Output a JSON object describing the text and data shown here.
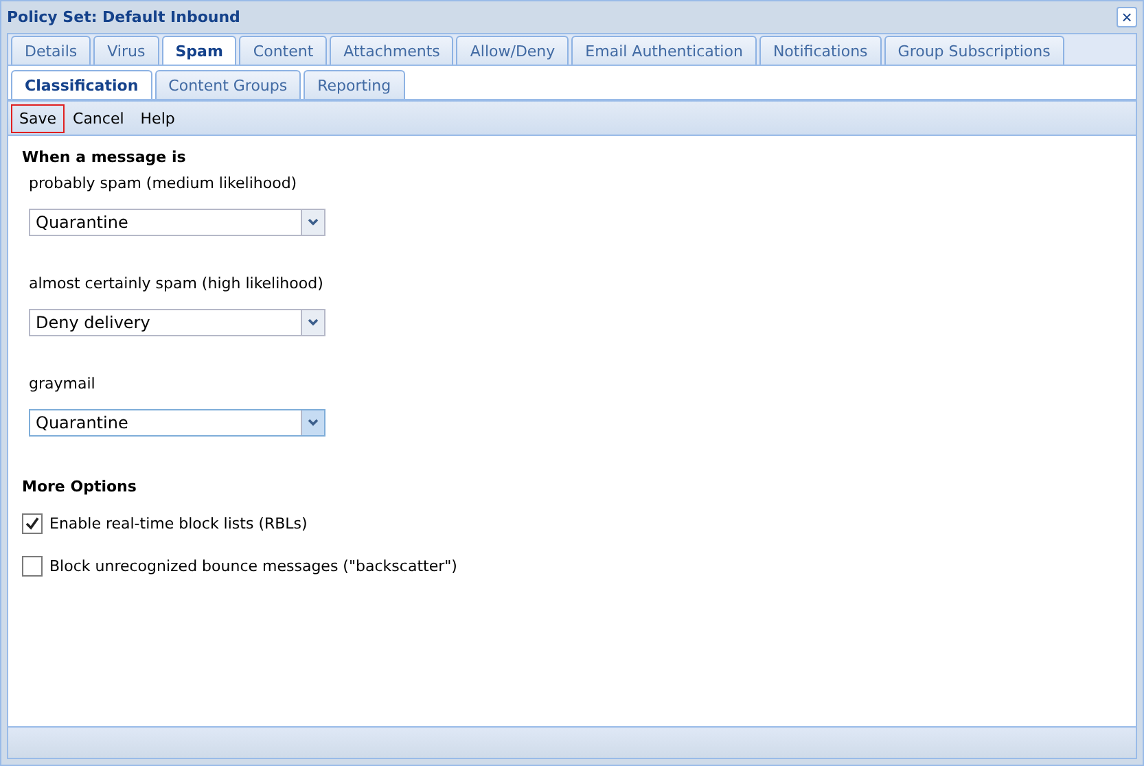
{
  "window": {
    "title": "Policy Set: Default Inbound",
    "close": "×"
  },
  "tabs": [
    {
      "label": "Details",
      "selected": false
    },
    {
      "label": "Virus",
      "selected": false
    },
    {
      "label": "Spam",
      "selected": true
    },
    {
      "label": "Content",
      "selected": false
    },
    {
      "label": "Attachments",
      "selected": false
    },
    {
      "label": "Allow/Deny",
      "selected": false
    },
    {
      "label": "Email Authentication",
      "selected": false
    },
    {
      "label": "Notifications",
      "selected": false
    },
    {
      "label": "Group Subscriptions",
      "selected": false
    }
  ],
  "subtabs": [
    {
      "label": "Classification",
      "selected": true
    },
    {
      "label": "Content Groups",
      "selected": false
    },
    {
      "label": "Reporting",
      "selected": false
    }
  ],
  "toolbar": [
    {
      "label": "Save",
      "focused": true
    },
    {
      "label": "Cancel",
      "focused": false
    },
    {
      "label": "Help",
      "focused": false
    }
  ],
  "section_title": "When a message is",
  "selects": [
    {
      "label": "probably spam (medium likelihood)",
      "value": "Quarantine",
      "focused": false
    },
    {
      "label": "almost certainly spam (high likelihood)",
      "value": "Deny delivery",
      "focused": false
    },
    {
      "label": "graymail",
      "value": "Quarantine",
      "focused": true
    }
  ],
  "options_title": "More Options",
  "options": [
    {
      "label": "Enable real-time block lists (RBLs)",
      "checked": true
    },
    {
      "label": "Block unrecognized bounce messages (\"backscatter\")",
      "checked": false
    }
  ]
}
